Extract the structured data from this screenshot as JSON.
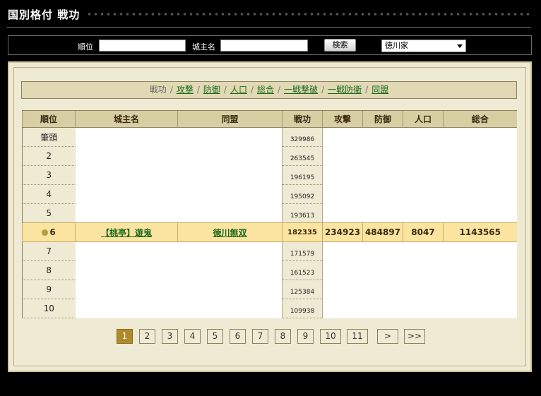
{
  "header": {
    "title": "国別格付 戦功"
  },
  "search": {
    "rank_label": "順位",
    "rank_value": "",
    "lord_label": "城主名",
    "lord_value": "",
    "button_label": "検索",
    "house_selected": "徳川家"
  },
  "categories": {
    "current": "戦功",
    "links": [
      "攻撃",
      "防御",
      "人口",
      "総合",
      "一戦撃破",
      "一戦防衛",
      "同盟"
    ]
  },
  "table": {
    "columns": [
      "順位",
      "城主名",
      "同盟",
      "戦功",
      "攻撃",
      "防御",
      "人口",
      "総合"
    ],
    "rows": [
      {
        "rank": "筆頭",
        "score": "329986"
      },
      {
        "rank": "2",
        "score": "263545"
      },
      {
        "rank": "3",
        "score": "196195"
      },
      {
        "rank": "4",
        "score": "195092"
      },
      {
        "rank": "5",
        "score": "193613"
      },
      {
        "rank": "6",
        "lord": "【桃亭】遊鬼",
        "alliance": "徳川無双",
        "score": "182335",
        "attack": "234923",
        "defense": "484897",
        "population": "8047",
        "total": "1143565",
        "highlighted": true
      },
      {
        "rank": "7",
        "score": "171579"
      },
      {
        "rank": "8",
        "score": "161523"
      },
      {
        "rank": "9",
        "score": "125384"
      },
      {
        "rank": "10",
        "score": "109938"
      }
    ]
  },
  "pagination": {
    "pages": [
      "1",
      "2",
      "3",
      "4",
      "5",
      "6",
      "7",
      "8",
      "9",
      "10",
      "11"
    ],
    "current": "1",
    "next_label": ">",
    "last_label": ">>"
  },
  "colors": {
    "background": "#000000",
    "panel": "#efead3",
    "header_cell": "#d7cea3",
    "highlight_row": "#fbe3a0",
    "link": "#1d6a1d",
    "active_page": "#b08a2a"
  }
}
